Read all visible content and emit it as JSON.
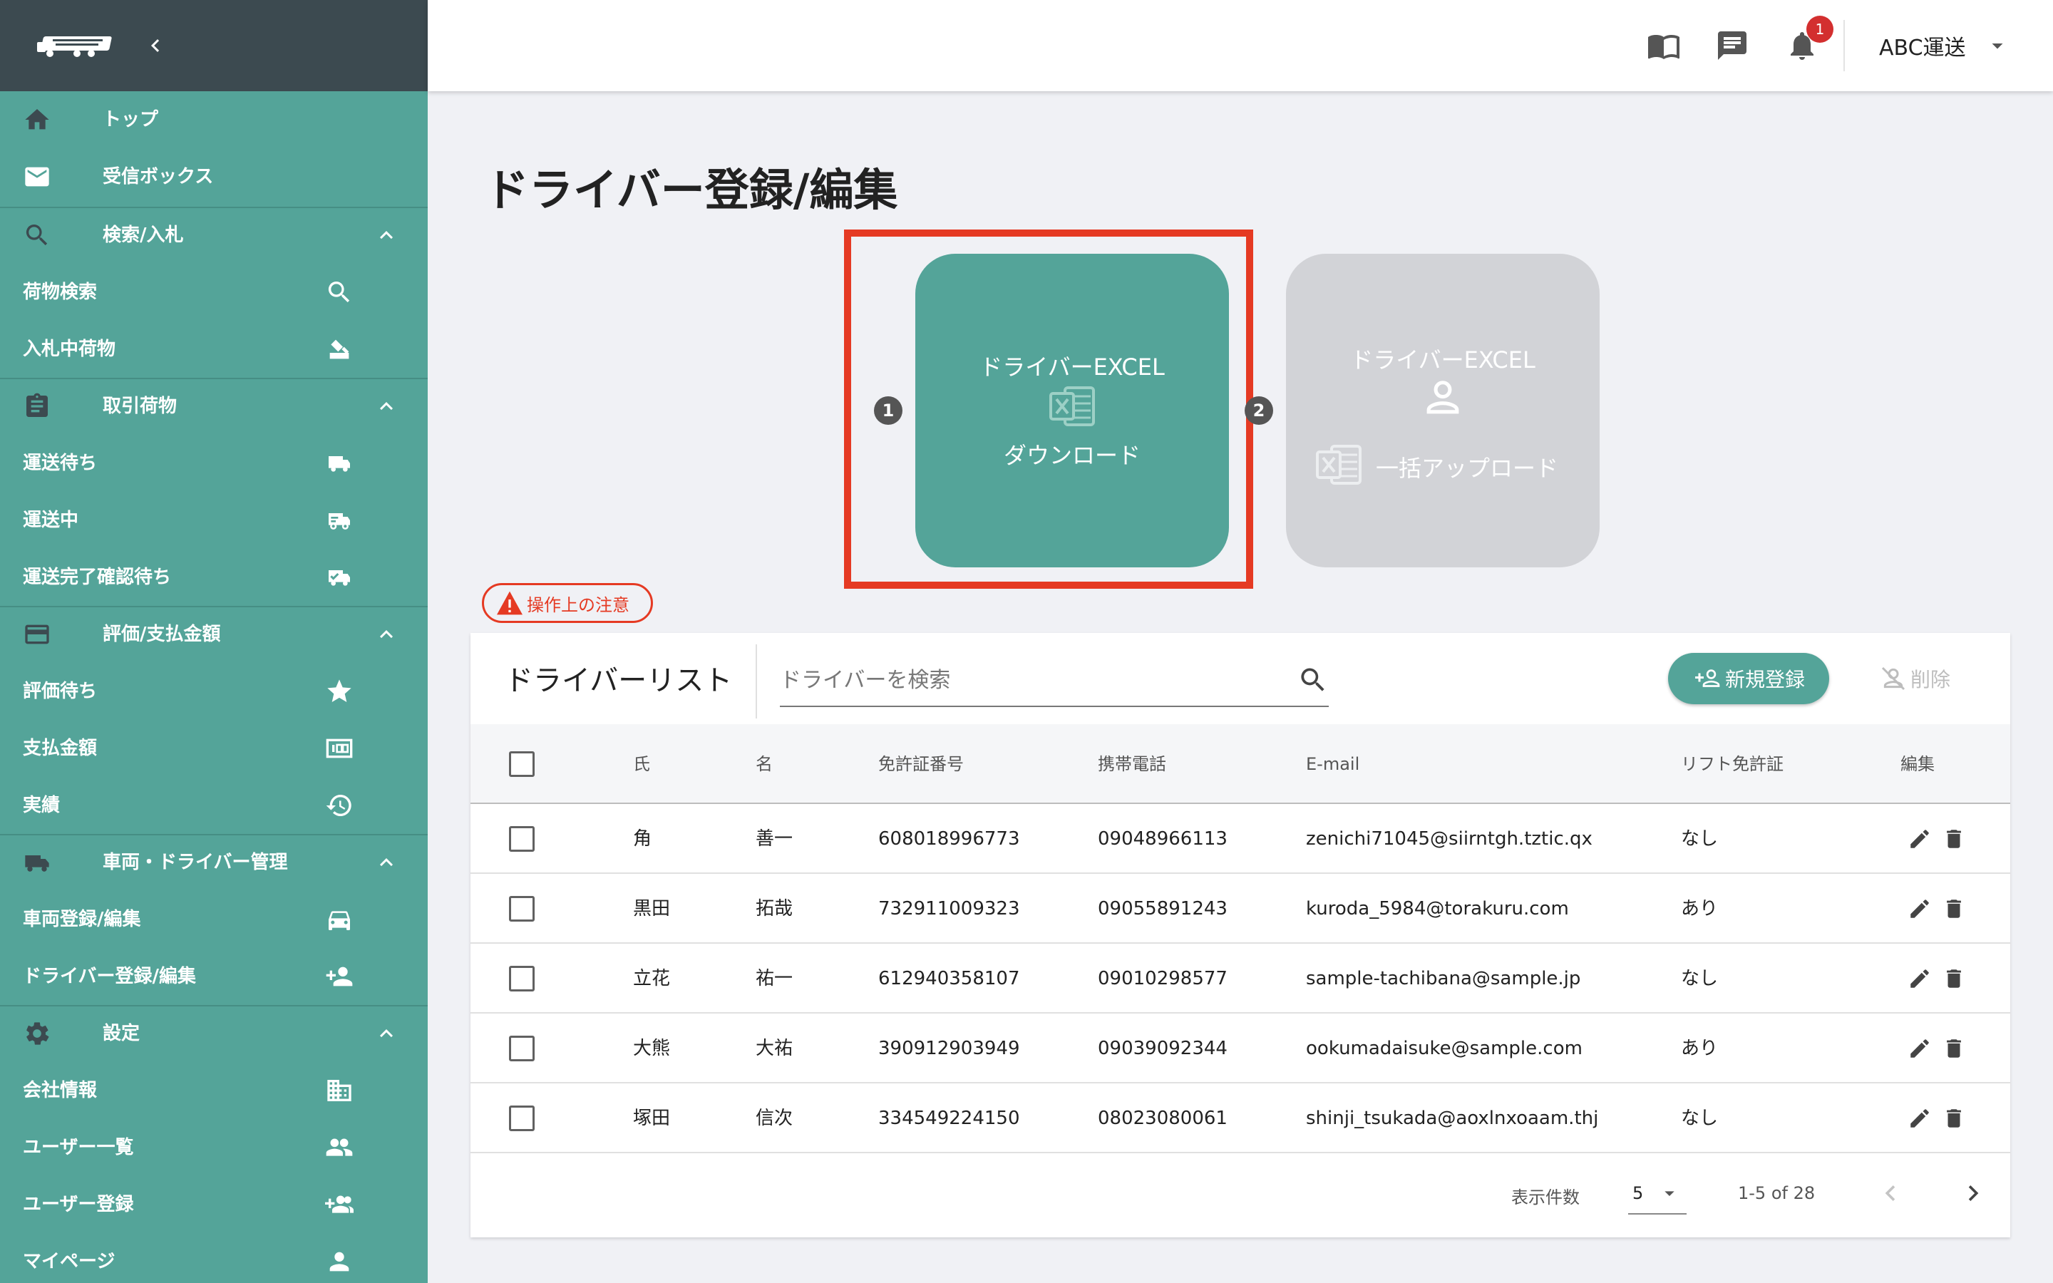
{
  "sidebar": {
    "items": [
      {
        "label": "トップ"
      },
      {
        "label": "受信ボックス"
      },
      {
        "label": "検索/入札"
      },
      {
        "label": "荷物検索"
      },
      {
        "label": "入札中荷物"
      },
      {
        "label": "取引荷物"
      },
      {
        "label": "運送待ち"
      },
      {
        "label": "運送中"
      },
      {
        "label": "運送完了確認待ち"
      },
      {
        "label": "評価/支払金額"
      },
      {
        "label": "評価待ち"
      },
      {
        "label": "支払金額"
      },
      {
        "label": "実績"
      },
      {
        "label": "車両・ドライバー管理"
      },
      {
        "label": "車両登録/編集"
      },
      {
        "label": "ドライバー登録/編集"
      },
      {
        "label": "設定"
      },
      {
        "label": "会社情報"
      },
      {
        "label": "ユーザー一覧"
      },
      {
        "label": "ユーザー登録"
      },
      {
        "label": "マイページ"
      }
    ]
  },
  "header": {
    "notification_count": "1",
    "company": "ABC運送"
  },
  "page": {
    "title": "ドライバー登録/編集"
  },
  "steps": [
    {
      "number": "1",
      "title": "ドライバーEXCEL",
      "action": "ダウンロード"
    },
    {
      "number": "2",
      "title": "ドライバーEXCEL",
      "action": "一括アップロード"
    }
  ],
  "notice": {
    "label": "操作上の注意"
  },
  "driver_list": {
    "title": "ドライバーリスト",
    "search_placeholder": "ドライバーを検索",
    "new_button": "新規登録",
    "delete_button": "削除",
    "columns": [
      "氏",
      "名",
      "免許証番号",
      "携帯電話",
      "E-mail",
      "リフト免許証",
      "編集"
    ],
    "rows": [
      {
        "last": "角",
        "first": "善一",
        "license": "608018996773",
        "phone": "09048966113",
        "email": "zenichi71045@siirntgh.tztic.qx",
        "lift": "なし"
      },
      {
        "last": "黒田",
        "first": "拓哉",
        "license": "732911009323",
        "phone": "09055891243",
        "email": "kuroda_5984@torakuru.com",
        "lift": "あり"
      },
      {
        "last": "立花",
        "first": "祐一",
        "license": "612940358107",
        "phone": "09010298577",
        "email": "sample-tachibana@sample.jp",
        "lift": "なし"
      },
      {
        "last": "大熊",
        "first": "大祐",
        "license": "390912903949",
        "phone": "09039092344",
        "email": "ookumadaisuke@sample.com",
        "lift": "あり"
      },
      {
        "last": "塚田",
        "first": "信次",
        "license": "334549224150",
        "phone": "08023080061",
        "email": "shinji_tsukada@aoxlnxoaam.thj",
        "lift": "なし"
      }
    ],
    "pagination": {
      "rows_per_page_label": "表示件数",
      "rows_per_page": "5",
      "range": "1-5 of 28"
    }
  },
  "colors": {
    "sidebar": "#54a499",
    "brand_bar": "#3c4a50",
    "accent": "#54a499",
    "highlight": "#e53a23",
    "disabled_card": "#d2d3d7",
    "badge": "#d32f2f"
  },
  "icons": {
    "header": [
      "book-icon",
      "chat-icon",
      "bell-icon",
      "dropdown-icon"
    ]
  }
}
